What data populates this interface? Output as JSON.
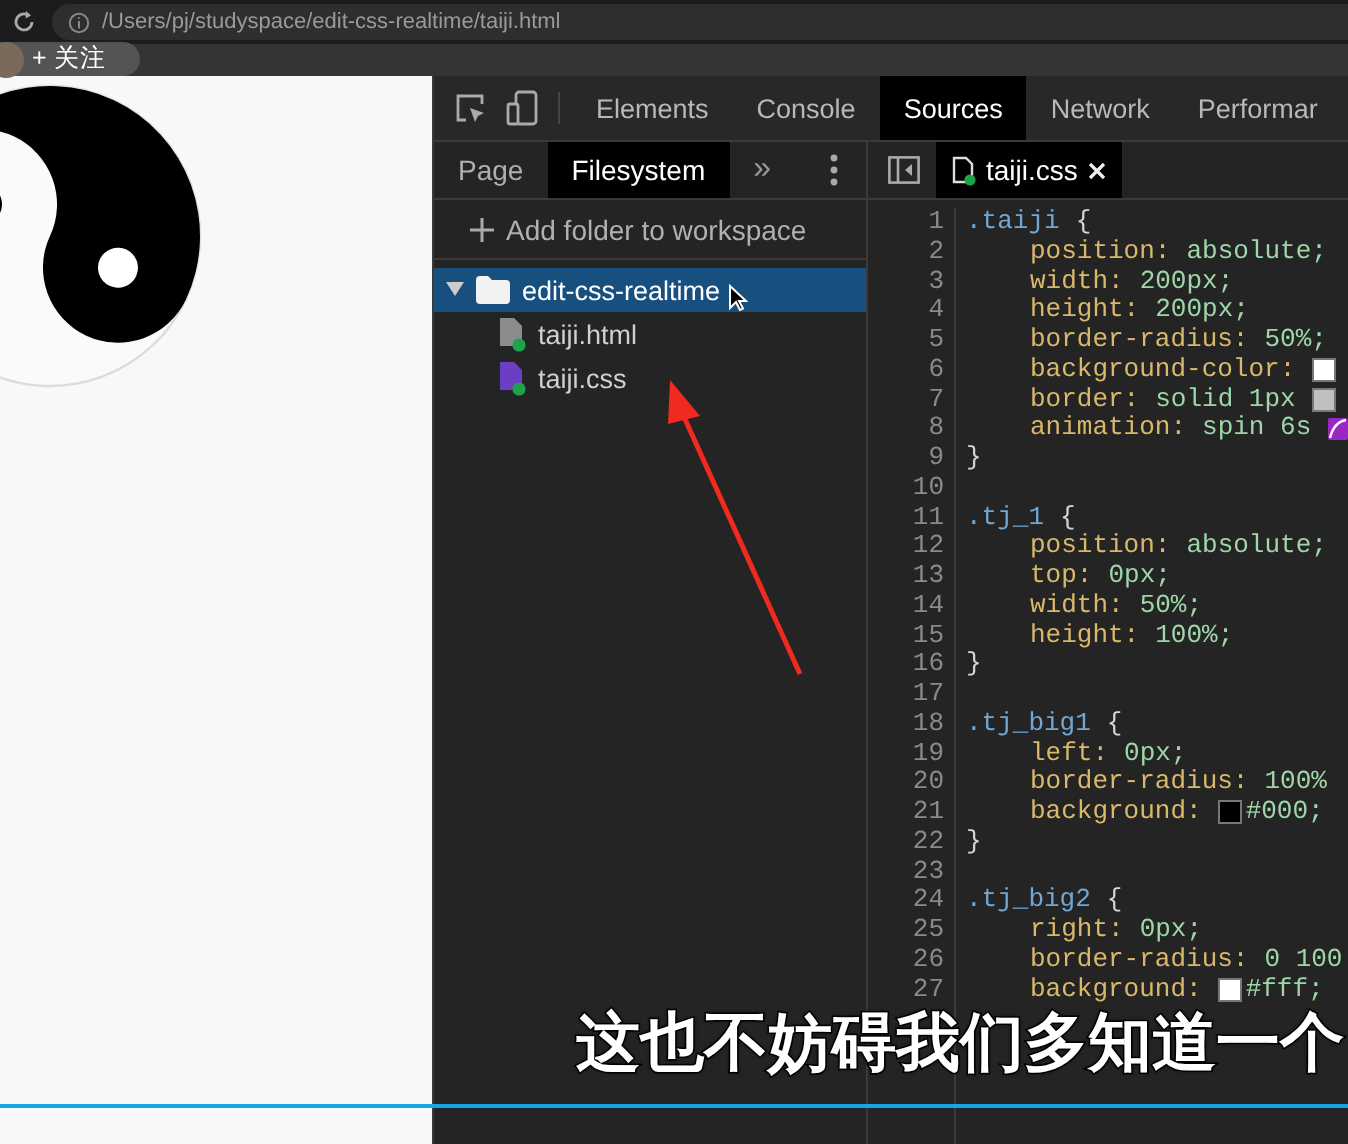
{
  "browser": {
    "url": "/Users/pj/studyspace/edit-css-realtime/taiji.html"
  },
  "follow_button": {
    "label": "+ 关注"
  },
  "devtools": {
    "tabs": [
      {
        "label": "Elements",
        "selected": false
      },
      {
        "label": "Console",
        "selected": false
      },
      {
        "label": "Sources",
        "selected": true
      },
      {
        "label": "Network",
        "selected": false
      },
      {
        "label": "Performar",
        "selected": false
      }
    ],
    "navigator_tabs": [
      {
        "label": "Page",
        "selected": false
      },
      {
        "label": "Filesystem",
        "selected": true
      }
    ],
    "more_tabs": "»",
    "add_folder": "Add folder to workspace",
    "tree": [
      {
        "name": "edit-css-realtime",
        "kind": "folder",
        "expanded": true,
        "selected": true,
        "children": [
          {
            "name": "taiji.html",
            "kind": "file",
            "color": "#8c8c8c",
            "selected": false
          },
          {
            "name": "taiji.css",
            "kind": "file",
            "color": "#6a3fc4",
            "selected": false
          }
        ]
      }
    ],
    "editor_tab": {
      "label": "taiji.css"
    },
    "code_lines": [
      {
        "kind": "rule",
        "n": "1",
        "selector": ".taiji",
        "brace": "{"
      },
      {
        "kind": "decl",
        "n": "2",
        "prop": "position:",
        "before": "absolute;"
      },
      {
        "kind": "decl",
        "n": "3",
        "prop": "width:",
        "before": "200px;"
      },
      {
        "kind": "decl",
        "n": "4",
        "prop": "height:",
        "before": "200px;"
      },
      {
        "kind": "decl",
        "n": "5",
        "prop": "border-radius:",
        "before": "50%;"
      },
      {
        "kind": "decl",
        "n": "6",
        "prop": "background-color:",
        "marker": {
          "kind": "color",
          "color": "#ffffff"
        }
      },
      {
        "kind": "decl",
        "n": "7",
        "prop": "border:",
        "before": "solid 1px",
        "marker": {
          "kind": "color",
          "color": "#c0c0c0"
        }
      },
      {
        "kind": "decl",
        "n": "8",
        "prop": "animation:",
        "before": "spin 6s",
        "marker": {
          "kind": "easing"
        }
      },
      {
        "kind": "close",
        "n": "9",
        "text": "}"
      },
      {
        "kind": "blank",
        "n": "10"
      },
      {
        "kind": "rule",
        "n": "11",
        "selector": ".tj_1",
        "brace": "{"
      },
      {
        "kind": "decl",
        "n": "12",
        "prop": "position:",
        "before": "absolute;"
      },
      {
        "kind": "decl",
        "n": "13",
        "prop": "top:",
        "before": "0px;"
      },
      {
        "kind": "decl",
        "n": "14",
        "prop": "width:",
        "before": "50%;"
      },
      {
        "kind": "decl",
        "n": "15",
        "prop": "height:",
        "before": "100%;"
      },
      {
        "kind": "close",
        "n": "16",
        "text": "}"
      },
      {
        "kind": "blank",
        "n": "17"
      },
      {
        "kind": "rule",
        "n": "18",
        "selector": ".tj_big1",
        "brace": "{"
      },
      {
        "kind": "decl",
        "n": "19",
        "prop": "left:",
        "before": "0px;"
      },
      {
        "kind": "decl",
        "n": "20",
        "prop": "border-radius:",
        "before": "100%"
      },
      {
        "kind": "decl",
        "n": "21",
        "prop": "background:",
        "marker": {
          "kind": "color",
          "color": "#000000"
        },
        "after": "#000;"
      },
      {
        "kind": "close",
        "n": "22",
        "text": "}"
      },
      {
        "kind": "blank",
        "n": "23"
      },
      {
        "kind": "rule",
        "n": "24",
        "selector": ".tj_big2",
        "brace": "{"
      },
      {
        "kind": "decl",
        "n": "25",
        "prop": "right:",
        "before": "0px;"
      },
      {
        "kind": "decl",
        "n": "26",
        "prop": "border-radius:",
        "before": "0 100"
      },
      {
        "kind": "decl",
        "n": "27",
        "prop": "background:",
        "marker": {
          "kind": "color",
          "color": "#ffffff"
        },
        "after": "#fff;"
      },
      {
        "kind": "covered"
      },
      {
        "kind": "covered"
      },
      {
        "kind": "covered"
      },
      {
        "kind": "covered"
      },
      {
        "kind": "covered"
      }
    ]
  },
  "subtitle": "这也不妨碍我们多知道一个"
}
